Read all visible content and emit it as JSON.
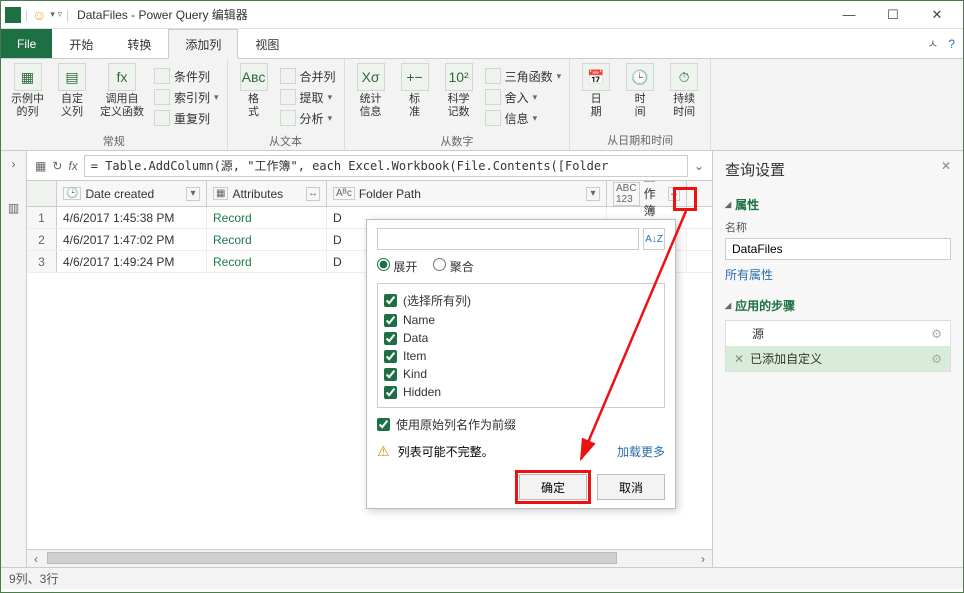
{
  "window": {
    "title": "DataFiles - Power Query 编辑器",
    "min": "—",
    "max": "☐",
    "close": "✕"
  },
  "menu": {
    "file": "File",
    "home": "开始",
    "transform": "转换",
    "addcol": "添加列",
    "view": "视图"
  },
  "ribbon": {
    "general": {
      "name": "常规",
      "examples": "示例中\n的列",
      "custom": "自定\n义列",
      "invoke": "调用自\n定义函数",
      "cond": "条件列",
      "index": "索引列",
      "dup": "重复列"
    },
    "text": {
      "name": "从文本",
      "format": "格\n式",
      "merge": "合并列",
      "extract": "提取",
      "parse": "分析"
    },
    "number": {
      "name": "从数字",
      "stats": "统计\n信息",
      "standard": "标\n准",
      "sci": "科学\n记数",
      "trig": "三角函数",
      "round": "舍入",
      "info": "信息"
    },
    "datetime": {
      "name": "从日期和时间",
      "date": "日\n期",
      "time": "时\n间",
      "duration": "持续\n时间"
    }
  },
  "formula": "= Table.AddColumn(源, \"工作簿\", each Excel.Workbook(File.Contents([Folder",
  "columns": {
    "date": "Date created",
    "attr": "Attributes",
    "folder": "Folder Path",
    "wb": "工作簿"
  },
  "rows": [
    {
      "n": "1",
      "date": "4/6/2017 1:45:38 PM",
      "attr": "Record",
      "f": "D"
    },
    {
      "n": "2",
      "date": "4/6/2017 1:47:02 PM",
      "attr": "Record",
      "f": "D"
    },
    {
      "n": "3",
      "date": "4/6/2017 1:49:24 PM",
      "attr": "Record",
      "f": "D"
    }
  ],
  "popup": {
    "expand": "展开",
    "aggregate": "聚合",
    "selectall": "(选择所有列)",
    "cols": [
      "Name",
      "Data",
      "Item",
      "Kind",
      "Hidden"
    ],
    "prefix": "使用原始列名作为前缀",
    "warn": "列表可能不完整。",
    "more": "加载更多",
    "ok": "确定",
    "cancel": "取消"
  },
  "settings": {
    "title": "查询设置",
    "props": "属性",
    "namelabel": "名称",
    "name": "DataFiles",
    "allprops": "所有属性",
    "stepslabel": "应用的步骤",
    "steps": [
      {
        "label": "源"
      },
      {
        "label": "已添加自定义",
        "x": true
      }
    ]
  },
  "status": "9列、3行"
}
